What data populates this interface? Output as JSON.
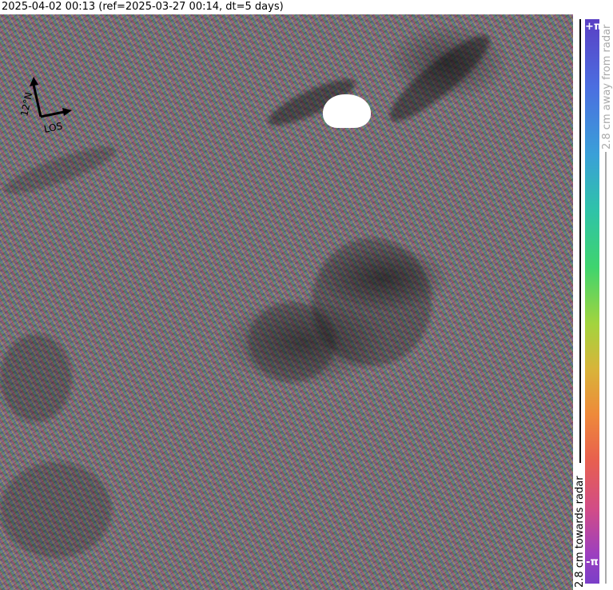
{
  "title": "2025-04-02 00:13 (ref=2025-03-27 00:14, dt=5 days)",
  "orientation": {
    "heading_label": "12°N",
    "los_label": "LOS"
  },
  "colorbar": {
    "top_label": "+π",
    "bottom_label": "-π",
    "away_label": "2.8 cm away from radar",
    "towards_label": "2.8 cm towards radar",
    "away_color": "#aaaaaa",
    "towards_color": "#000000"
  }
}
